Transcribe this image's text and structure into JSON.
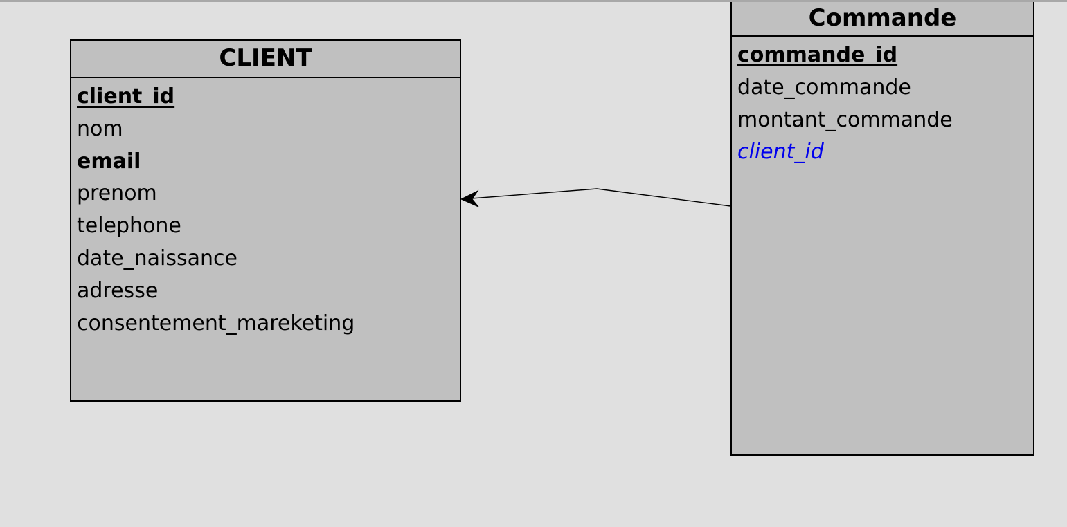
{
  "entities": {
    "client": {
      "title": "CLIENT",
      "attributes": [
        {
          "name": "client_id",
          "kind": "pk"
        },
        {
          "name": "nom",
          "kind": "normal"
        },
        {
          "name": "email",
          "kind": "bold"
        },
        {
          "name": "prenom",
          "kind": "normal"
        },
        {
          "name": "telephone",
          "kind": "normal"
        },
        {
          "name": "date_naissance",
          "kind": "normal"
        },
        {
          "name": "adresse",
          "kind": "normal"
        },
        {
          "name": "consentement_mareketing",
          "kind": "normal"
        }
      ]
    },
    "commande": {
      "title": "Commande",
      "attributes": [
        {
          "name": "commande_id",
          "kind": "pk"
        },
        {
          "name": "date_commande",
          "kind": "normal"
        },
        {
          "name": "montant_commande",
          "kind": "normal"
        },
        {
          "name": "client_id",
          "kind": "fk"
        }
      ]
    }
  },
  "relations": [
    {
      "from": "commande.client_id",
      "to": "client",
      "type": "foreign-key-arrow"
    }
  ],
  "colors": {
    "background": "#e0e0e0",
    "entity_fill": "#c0c0c0",
    "border": "#000000",
    "foreign_key": "#0000ee"
  }
}
